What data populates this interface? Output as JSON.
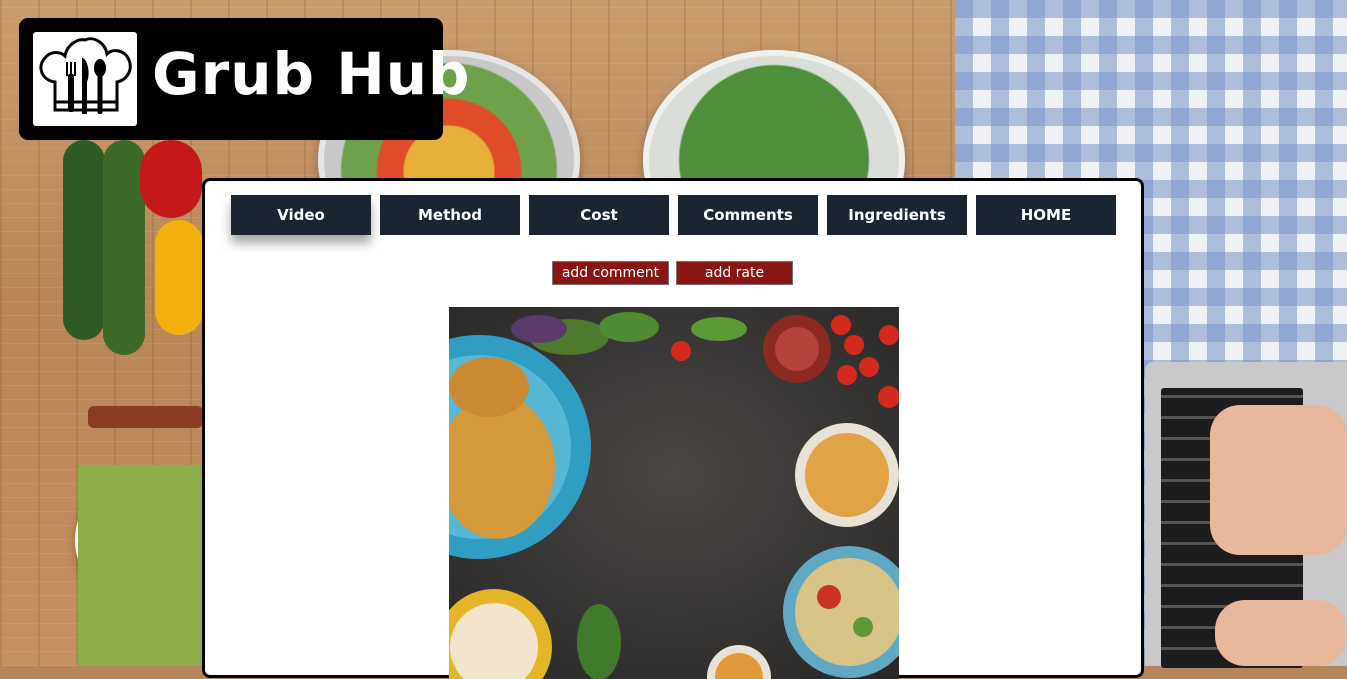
{
  "brand": {
    "name": "Grub Hub",
    "logo_icon": "chef-hat-cutlery-icon"
  },
  "nav": {
    "items": [
      {
        "label": "Video",
        "active": true
      },
      {
        "label": "Method",
        "active": false
      },
      {
        "label": "Cost",
        "active": false
      },
      {
        "label": "Comments",
        "active": false
      },
      {
        "label": "Ingredients",
        "active": false
      },
      {
        "label": "HOME",
        "active": false
      }
    ]
  },
  "actions": {
    "add_comment_label": "add comment",
    "add_rate_label": "add rate"
  },
  "colors": {
    "nav_bg": "#1b2532",
    "action_bg": "#8a1512",
    "logo_bg": "#000000"
  }
}
